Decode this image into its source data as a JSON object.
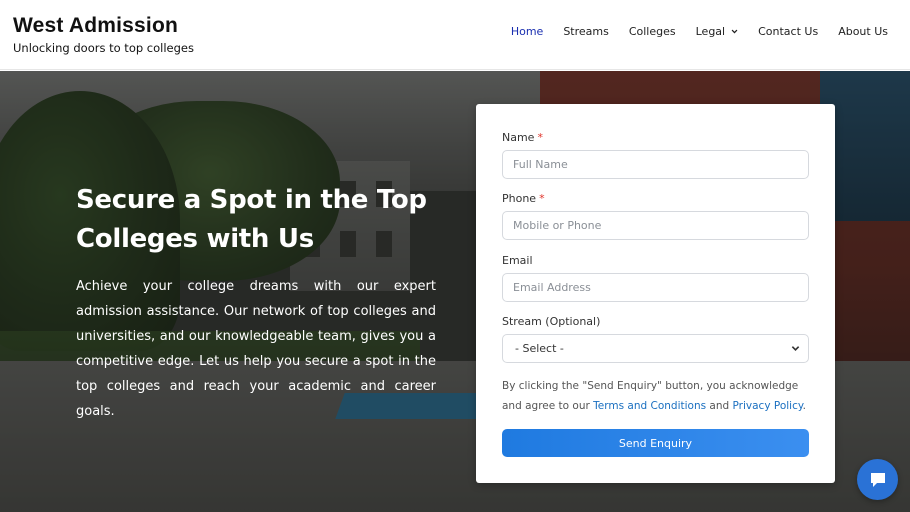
{
  "brand": {
    "title": "West Admission",
    "tagline": "Unlocking doors to top colleges"
  },
  "nav": {
    "items": [
      {
        "label": "Home",
        "active": true
      },
      {
        "label": "Streams"
      },
      {
        "label": "Colleges"
      },
      {
        "label": "Legal",
        "has_dropdown": true
      },
      {
        "label": "Contact Us"
      },
      {
        "label": "About Us"
      }
    ]
  },
  "hero": {
    "title": "Secure a Spot in the Top Colleges with Us",
    "body": "Achieve your college dreams with our expert admission assistance. Our network of top colleges and universities, and our knowledgeable team, gives you a competitive edge. Let us help you secure a spot in the top colleges and reach your academic and career goals."
  },
  "form": {
    "name_label": "Name",
    "name_placeholder": "Full Name",
    "phone_label": "Phone",
    "phone_placeholder": "Mobile or Phone",
    "email_label": "Email",
    "email_placeholder": "Email Address",
    "stream_label": "Stream (Optional)",
    "stream_selected": "- Select -",
    "required_marker": "*",
    "consent_prefix": "By clicking the \"Send Enquiry\" button, you acknowledge and agree to our ",
    "terms_link": "Terms and Conditions",
    "consent_and": " and ",
    "privacy_link": "Privacy Policy",
    "consent_suffix": ".",
    "submit_label": "Send Enquiry"
  },
  "colors": {
    "nav_active": "#1a2fb0",
    "link": "#1a6fc0",
    "required": "#e0342b",
    "button": "#1f7ae0",
    "chat": "#2a72d6"
  },
  "icons": {
    "nav_dropdown": "chevron-down-icon",
    "chat": "chat-bubble-icon",
    "select": "chevron-down-icon"
  }
}
